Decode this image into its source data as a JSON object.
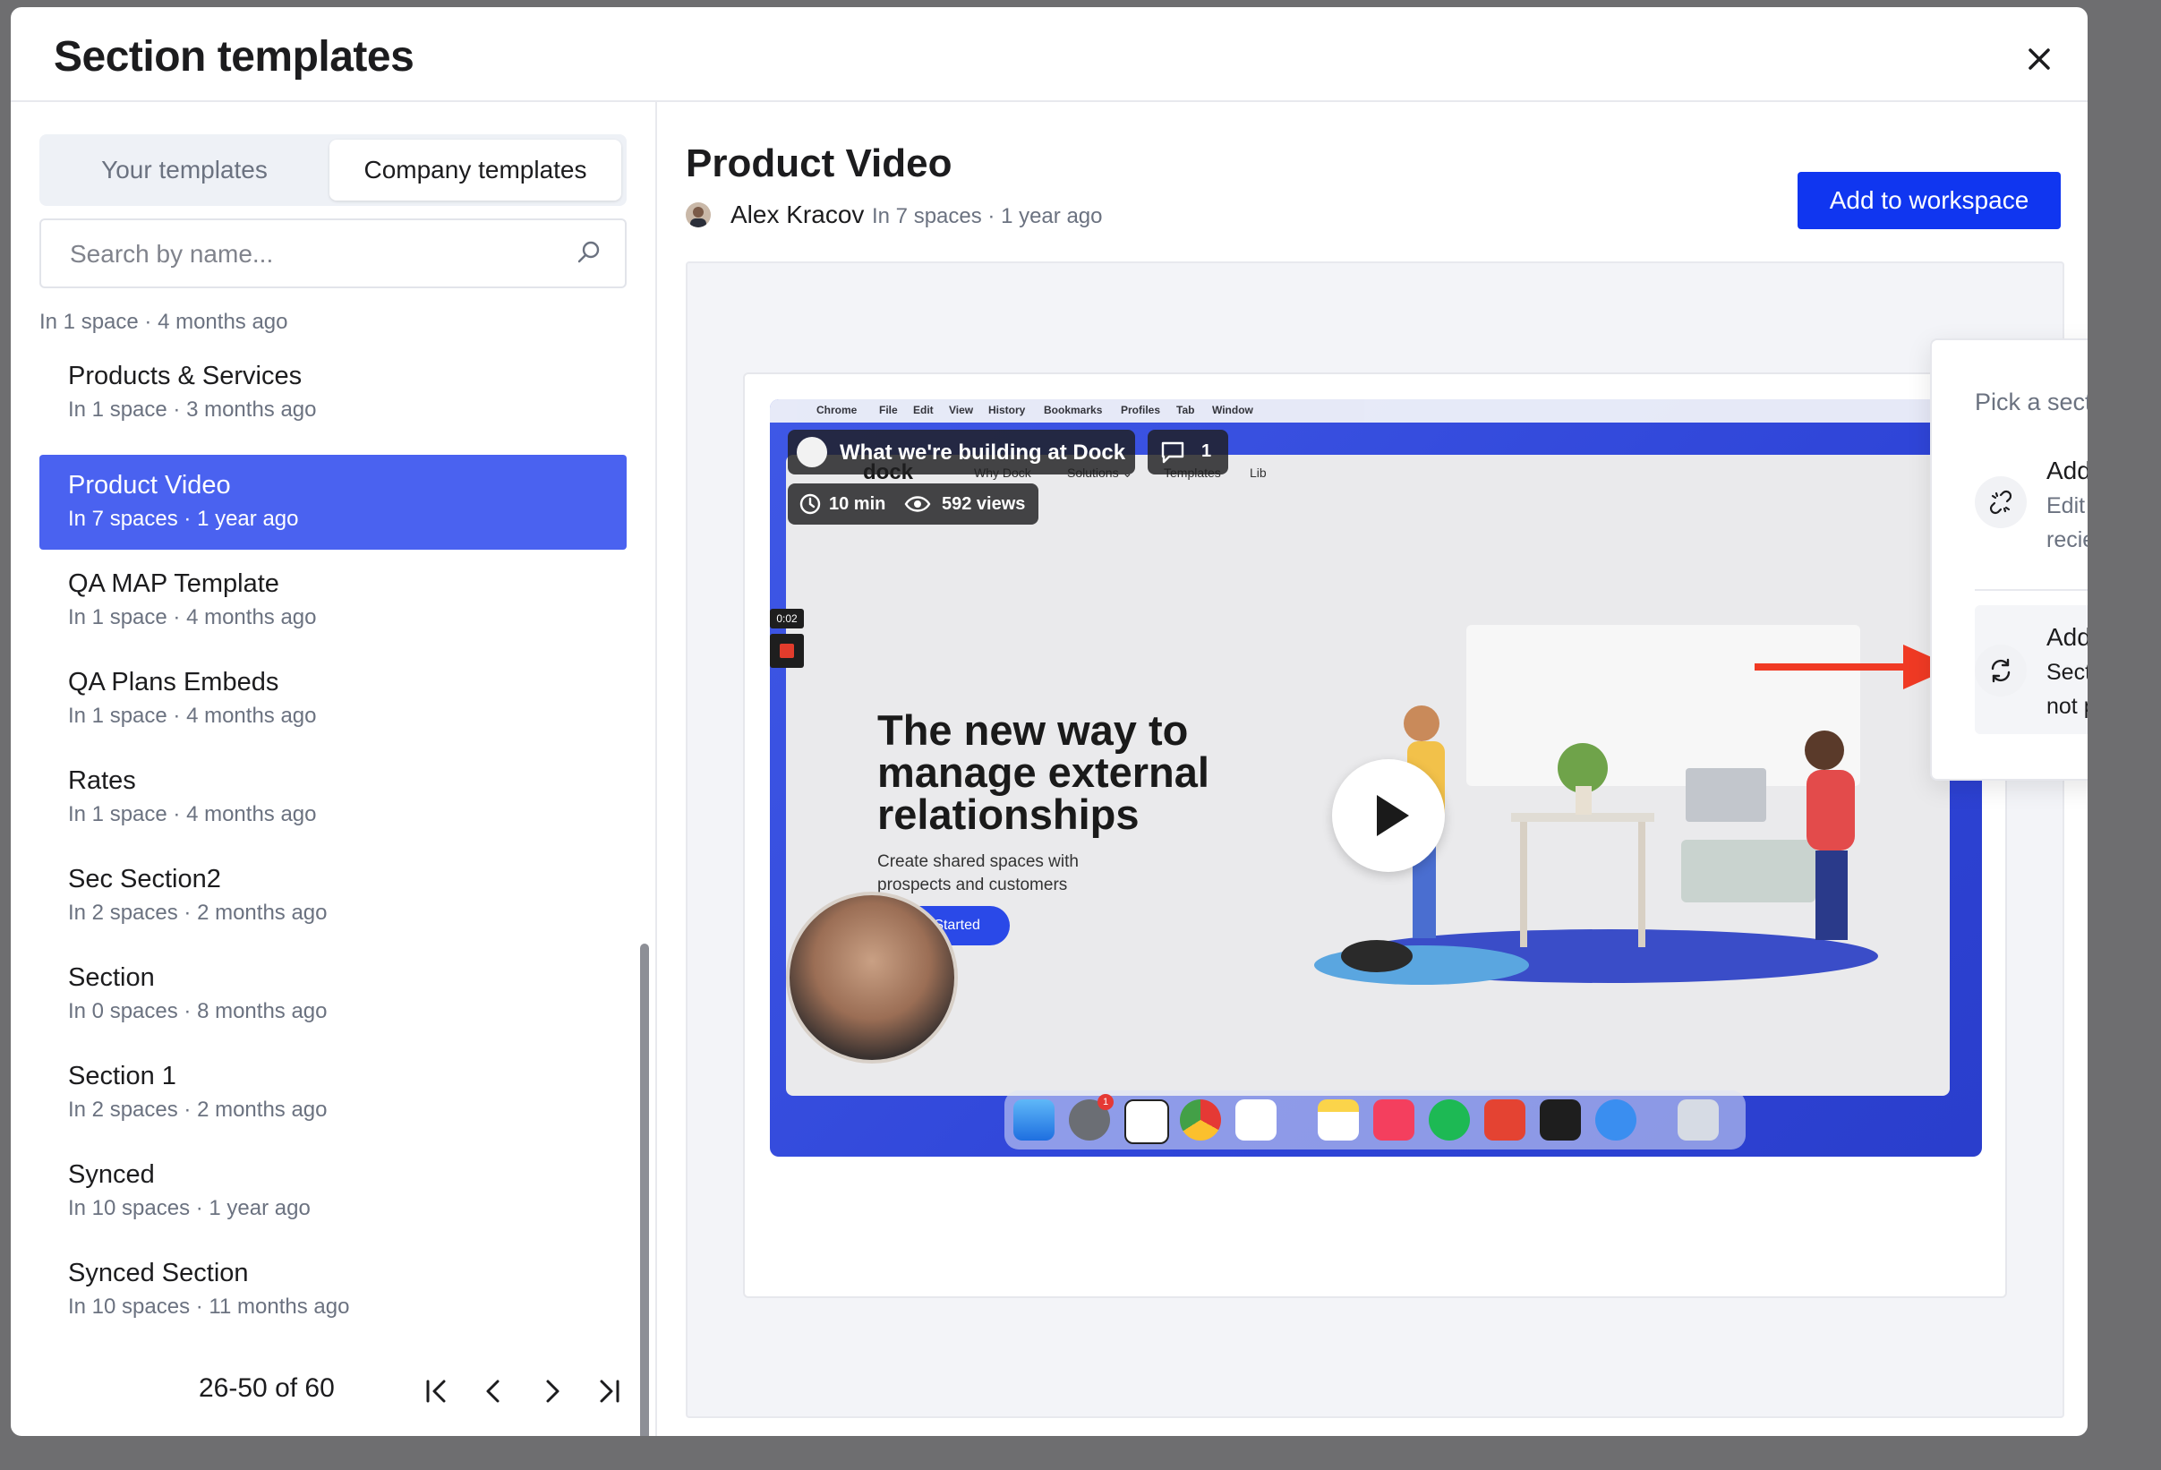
{
  "modal": {
    "title": "Section templates"
  },
  "tabs": [
    {
      "label": "Your templates",
      "active": false
    },
    {
      "label": "Company templates",
      "active": true
    }
  ],
  "search": {
    "placeholder": "Search by name..."
  },
  "list": {
    "top_meta": "In 1 space · 4 months ago",
    "items": [
      {
        "name": "Products & Services",
        "meta": "In 1 space · 3 months ago"
      },
      {
        "name": "Product Video",
        "meta": "In 7 spaces · 1 year ago",
        "selected": true
      },
      {
        "name": "QA MAP Template",
        "meta": "In 1 space · 4 months ago"
      },
      {
        "name": "QA Plans Embeds",
        "meta": "In 1 space · 4 months ago"
      },
      {
        "name": "Rates",
        "meta": "In 1 space · 4 months ago"
      },
      {
        "name": "Sec Section2",
        "meta": "In 2 spaces · 2 months ago"
      },
      {
        "name": "Section",
        "meta": "In 0 spaces · 8 months ago"
      },
      {
        "name": "Section 1",
        "meta": "In 2 spaces · 2 months ago"
      },
      {
        "name": "Synced",
        "meta": "In 10 spaces · 1 year ago"
      },
      {
        "name": "Synced Section",
        "meta": "In 10 spaces · 11 months ago"
      }
    ]
  },
  "pagination": {
    "text": "26-50 of 60"
  },
  "detail": {
    "title": "Product Video",
    "author": "Alex Kracov",
    "meta": "In 7 spaces · 1 year ago",
    "add_button": "Add to workspace"
  },
  "video": {
    "menubar": [
      "Chrome",
      "File",
      "Edit",
      "View",
      "History",
      "Bookmarks",
      "Profiles",
      "Tab",
      "Window"
    ],
    "title": "What we're building at Dock",
    "comments": "1",
    "duration": "10 min",
    "views": "592 views",
    "rec_time": "0:02",
    "site_logo": "dock",
    "site_nav": [
      "Why Dock",
      "Solutions ⌄",
      "Templates",
      "Lib"
    ],
    "hero_title": "The new way to manage external relationships",
    "hero_sub": "Create shared spaces with prospects and customers",
    "hero_button": "Get Started",
    "badge": "1"
  },
  "popup": {
    "heading": "Pick a section type to add to the space",
    "options": [
      {
        "title": "Add editable section",
        "desc": "Edit the section from the within the editor. This section will not recieve automated updates."
      },
      {
        "title": "Add synced section",
        "desc": "Section will automatically update with the latest content. It's not possible to edit this section from the editor."
      }
    ]
  },
  "colors": {
    "accent": "#1036f0",
    "selected_row": "#4a62f0",
    "annotation_arrow": "#f03a24"
  }
}
